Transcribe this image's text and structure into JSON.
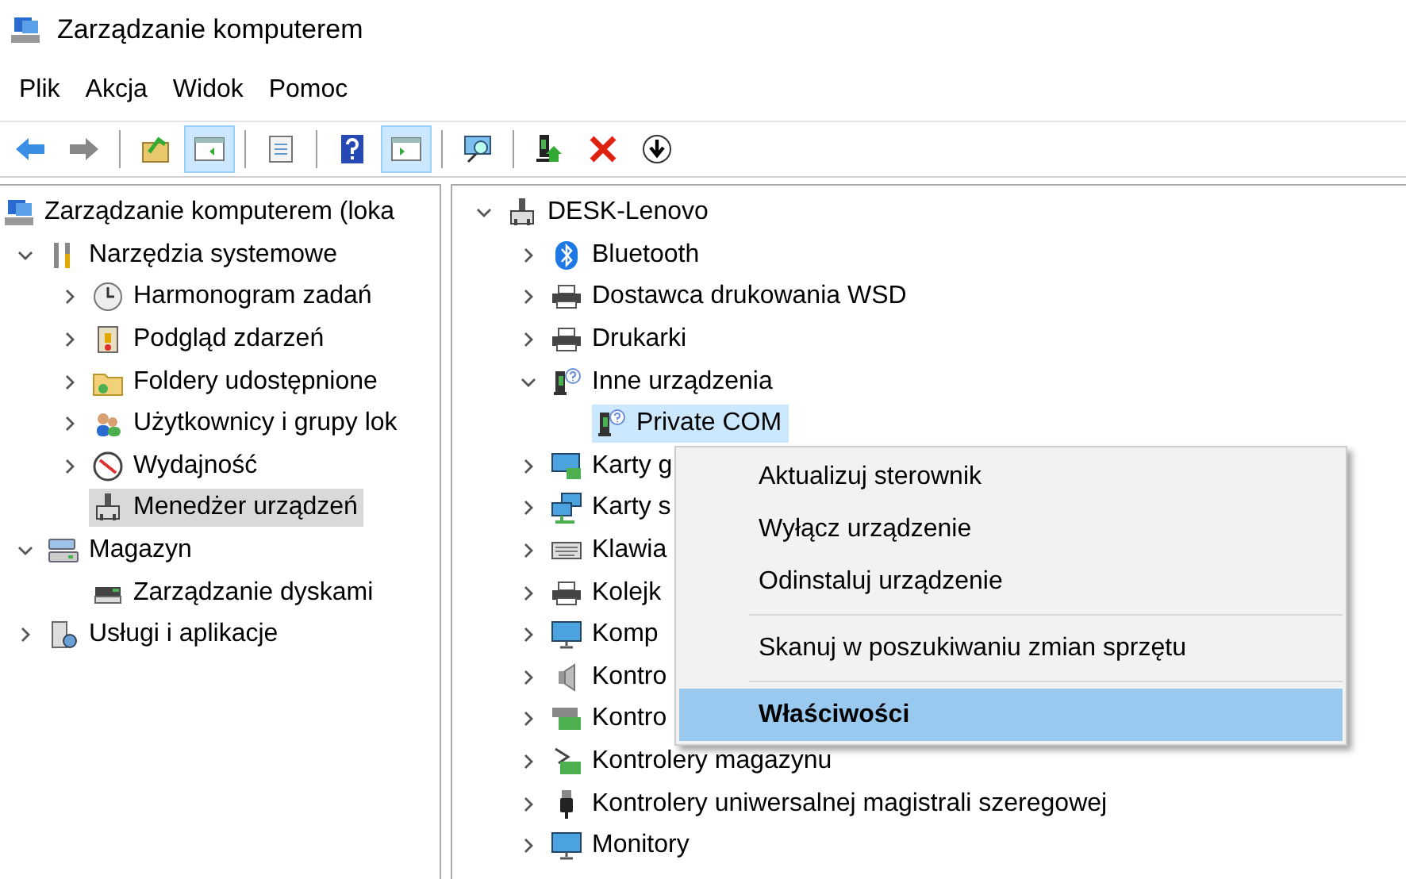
{
  "window": {
    "title": "Zarządzanie komputerem"
  },
  "menu_bar": [
    "Plik",
    "Akcja",
    "Widok",
    "Pomoc"
  ],
  "toolbar": [
    [
      {
        "pressed": false
      },
      {
        "pressed": false
      }
    ],
    [
      {
        "pressed": false
      },
      {
        "pressed": true
      }
    ],
    [
      {
        "pressed": false
      }
    ],
    [
      {
        "pressed": false
      },
      {
        "pressed": true
      }
    ],
    [
      {
        "pressed": false
      }
    ],
    [
      {
        "pressed": false
      },
      {
        "pressed": false
      },
      {
        "pressed": false
      }
    ]
  ],
  "console_tree": {
    "root": {
      "label": "Zarządzanie komputerem (loka",
      "selected": false,
      "children": [
        {
          "label": "Narzędzia systemowe",
          "expanded": true,
          "selected": false,
          "children": [
            {
              "label": "Harmonogram zadań",
              "expanded": false,
              "selected": false
            },
            {
              "label": "Podgląd zdarzeń",
              "expanded": false,
              "selected": false
            },
            {
              "label": "Foldery udostępnione",
              "expanded": false,
              "selected": false
            },
            {
              "label": "Użytkownicy i grupy lok",
              "expanded": false,
              "selected": false
            },
            {
              "label": "Wydajność",
              "expanded": false,
              "selected": false
            },
            {
              "label": "Menedżer urządzeń",
              "selected": true
            }
          ]
        },
        {
          "label": "Magazyn",
          "expanded": true,
          "selected": false,
          "children": [
            {
              "label": "Zarządzanie dyskami",
              "selected": false
            }
          ]
        },
        {
          "label": "Usługi i aplikacje",
          "expanded": false,
          "selected": false
        }
      ]
    }
  },
  "device_tree": {
    "root": {
      "label": "DESK-Lenovo",
      "expanded": true,
      "selected": false,
      "children": [
        {
          "label": "Bluetooth",
          "expanded": false,
          "selected": false
        },
        {
          "label": "Dostawca drukowania WSD",
          "expanded": false,
          "selected": false
        },
        {
          "label": "Drukarki",
          "expanded": false,
          "selected": false
        },
        {
          "label": "Inne urządzenia",
          "expanded": true,
          "selected": false,
          "children": [
            {
              "label": "Private COM",
              "selected": true
            }
          ]
        },
        {
          "label": "Karty g",
          "expanded": false,
          "selected": false
        },
        {
          "label": "Karty s",
          "expanded": false,
          "selected": false
        },
        {
          "label": "Klawia",
          "expanded": false,
          "selected": false
        },
        {
          "label": "Kolejk",
          "expanded": false,
          "selected": false
        },
        {
          "label": "Komp",
          "expanded": false,
          "selected": false
        },
        {
          "label": "Kontro",
          "expanded": false,
          "selected": false
        },
        {
          "label": "Kontro",
          "expanded": false,
          "selected": false
        },
        {
          "label": "Kontrolery magazynu",
          "expanded": false,
          "selected": false
        },
        {
          "label": "Kontrolery uniwersalnej magistrali szeregowej",
          "expanded": false,
          "selected": false
        },
        {
          "label": "Monitory",
          "expanded": false,
          "selected": false
        }
      ]
    }
  },
  "context_menu": {
    "groups": [
      [
        {
          "label": "Aktualizuj sterownik",
          "selected": false,
          "default": false
        },
        {
          "label": "Wyłącz urządzenie",
          "selected": false,
          "default": false
        },
        {
          "label": "Odinstaluj urządzenie",
          "selected": false,
          "default": false
        }
      ],
      [
        {
          "label": "Skanuj w poszukiwaniu zmian sprzętu",
          "selected": false,
          "default": false
        }
      ],
      [
        {
          "label": "Właściwości",
          "selected": true,
          "default": true
        }
      ]
    ]
  }
}
